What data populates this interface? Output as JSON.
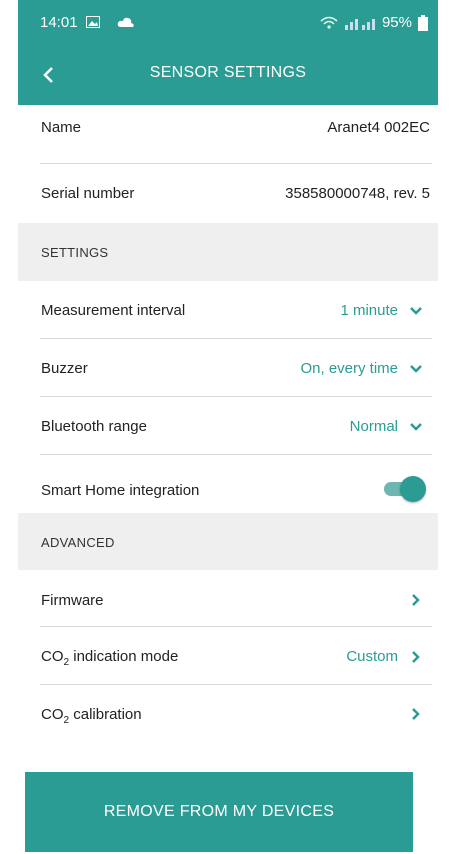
{
  "status": {
    "time": "14:01",
    "battery": "95%"
  },
  "appbar": {
    "title": "SENSOR SETTINGS"
  },
  "info": {
    "name_label": "Name",
    "name_value": "Aranet4 002EC",
    "serial_label": "Serial number",
    "serial_value": "358580000748, rev. 5"
  },
  "settings": {
    "header": "SETTINGS",
    "interval_label": "Measurement interval",
    "interval_value": "1 minute",
    "buzzer_label": "Buzzer",
    "buzzer_value": "On, every time",
    "bluetooth_label": "Bluetooth range",
    "bluetooth_value": "Normal",
    "smarthome_label": "Smart Home integration",
    "smarthome_enabled": true
  },
  "advanced": {
    "header": "ADVANCED",
    "firmware_label": "Firmware",
    "co2_prefix": "CO",
    "co2_sub": "2",
    "indication_suffix": " indication mode",
    "indication_value": "Custom",
    "calibration_suffix": " calibration"
  },
  "remove_button": {
    "label": "REMOVE FROM MY DEVICES"
  },
  "colors": {
    "primary": "#2a9c94",
    "section_bg": "#efefef"
  }
}
